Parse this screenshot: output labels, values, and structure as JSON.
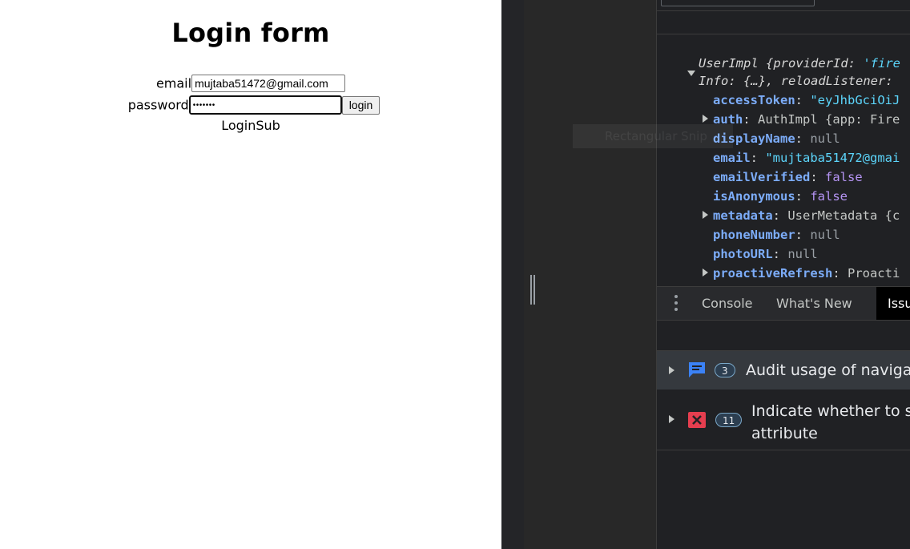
{
  "page": {
    "title": "Login form",
    "email_label": "email",
    "email_value": "mujtaba51472@gmail.com",
    "password_label": "password",
    "password_value": "•••••••",
    "login_button": "login",
    "sub_text": "LoginSub"
  },
  "devtools": {
    "object": {
      "header_class": "UserImpl",
      "header_provider_key": "providerId:",
      "header_provider_val": "'fire",
      "info_line_1": "Info:",
      "info_line_2": "{…},",
      "info_line_3": "reloadListener:",
      "access_token_key": "accessToken",
      "access_token_val": "\"eyJhbGciOiJ",
      "auth_key": "auth",
      "auth_val": "AuthImpl {app: Fire",
      "display_name_key": "displayName",
      "display_name_val": "null",
      "email_key": "email",
      "email_val": "\"mujtaba51472@gmai",
      "email_verified_key": "emailVerified",
      "email_verified_val": "false",
      "is_anonymous_key": "isAnonymous",
      "is_anonymous_val": "false",
      "metadata_key": "metadata",
      "metadata_val": "UserMetadata {c",
      "phone_key": "phoneNumber",
      "phone_val": "null",
      "photo_key": "photoURL",
      "photo_val": "null",
      "proactive_key": "proactiveRefresh",
      "proactive_val": "Proacti"
    },
    "tabs": {
      "console": "Console",
      "whats_new": "What's New",
      "issues": "Issu"
    },
    "issues": [
      {
        "count": "3",
        "text": "Audit usage of navigat"
      },
      {
        "count": "11",
        "text_line1": "Indicate whether to se",
        "text_line2": "attribute"
      }
    ],
    "snip_text": "Rectangular Snip"
  },
  "colors": {
    "devtools_bg": "#202124",
    "string": "#5cd5fb",
    "property": "#7cacf8",
    "boolean": "#b695f5",
    "info_icon": "#3b82f6",
    "error_icon": "#e53e4f"
  }
}
